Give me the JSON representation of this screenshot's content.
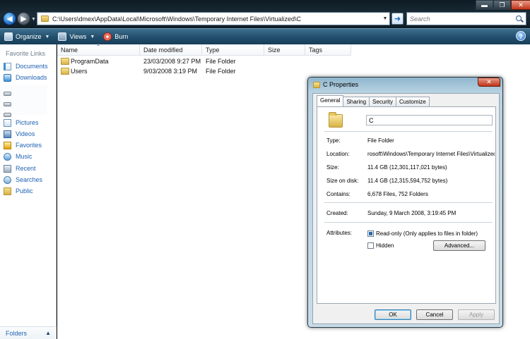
{
  "address": {
    "path": "C:\\Users\\dmex\\AppData\\Local\\Microsoft\\Windows\\Temporary Internet Files\\Virtualized\\C"
  },
  "search": {
    "placeholder": "Search"
  },
  "window_controls": {
    "minimize": "▬",
    "maximize": "❐",
    "close": "✕"
  },
  "toolbar": {
    "organize_label": "Organize",
    "views_label": "Views",
    "burn_label": "Burn",
    "help_label": "?"
  },
  "nav": {
    "favorite_links_title": "Favorite Links",
    "top_links": [
      "Documents",
      "Downloads"
    ],
    "links": [
      "Pictures",
      "Videos",
      "Favorites",
      "Music",
      "Recent",
      "Searches",
      "Public"
    ],
    "folders_label": "Folders",
    "folders_chevron": "▲"
  },
  "filelist": {
    "columns": [
      "Name",
      "Date modified",
      "Type",
      "Size",
      "Tags"
    ],
    "rows": [
      {
        "name": "ProgramData",
        "date": "23/03/2008 9:27 PM",
        "type": "File Folder",
        "size": ""
      },
      {
        "name": "Users",
        "date": "9/03/2008 3:19 PM",
        "type": "File Folder",
        "size": ""
      }
    ]
  },
  "dialog": {
    "title": "C Properties",
    "close_label": "✕",
    "tabs": [
      "General",
      "Sharing",
      "Security",
      "Customize"
    ],
    "active_tab": "General",
    "name_value": "C",
    "labels": {
      "type": "Type:",
      "location": "Location:",
      "size": "Size:",
      "size_on_disk": "Size on disk:",
      "contains": "Contains:",
      "created": "Created:",
      "attributes": "Attributes:"
    },
    "values": {
      "type": "File Folder",
      "location": "rosoft\\Windows\\Temporary Internet Files\\Virtualized",
      "size": "11.4 GB (12,301,117,021 bytes)",
      "size_on_disk": "11.4 GB (12,315,594,752 bytes)",
      "contains": "6,678 Files, 752 Folders",
      "created": "Sunday, 9 March 2008, 3:19:45 PM"
    },
    "readonly_label": "Read-only (Only applies to files in folder)",
    "readonly_state": "indeterminate",
    "hidden_label": "Hidden",
    "hidden_state": "unchecked",
    "advanced_label": "Advanced...",
    "ok_label": "OK",
    "cancel_label": "Cancel",
    "apply_label": "Apply"
  }
}
